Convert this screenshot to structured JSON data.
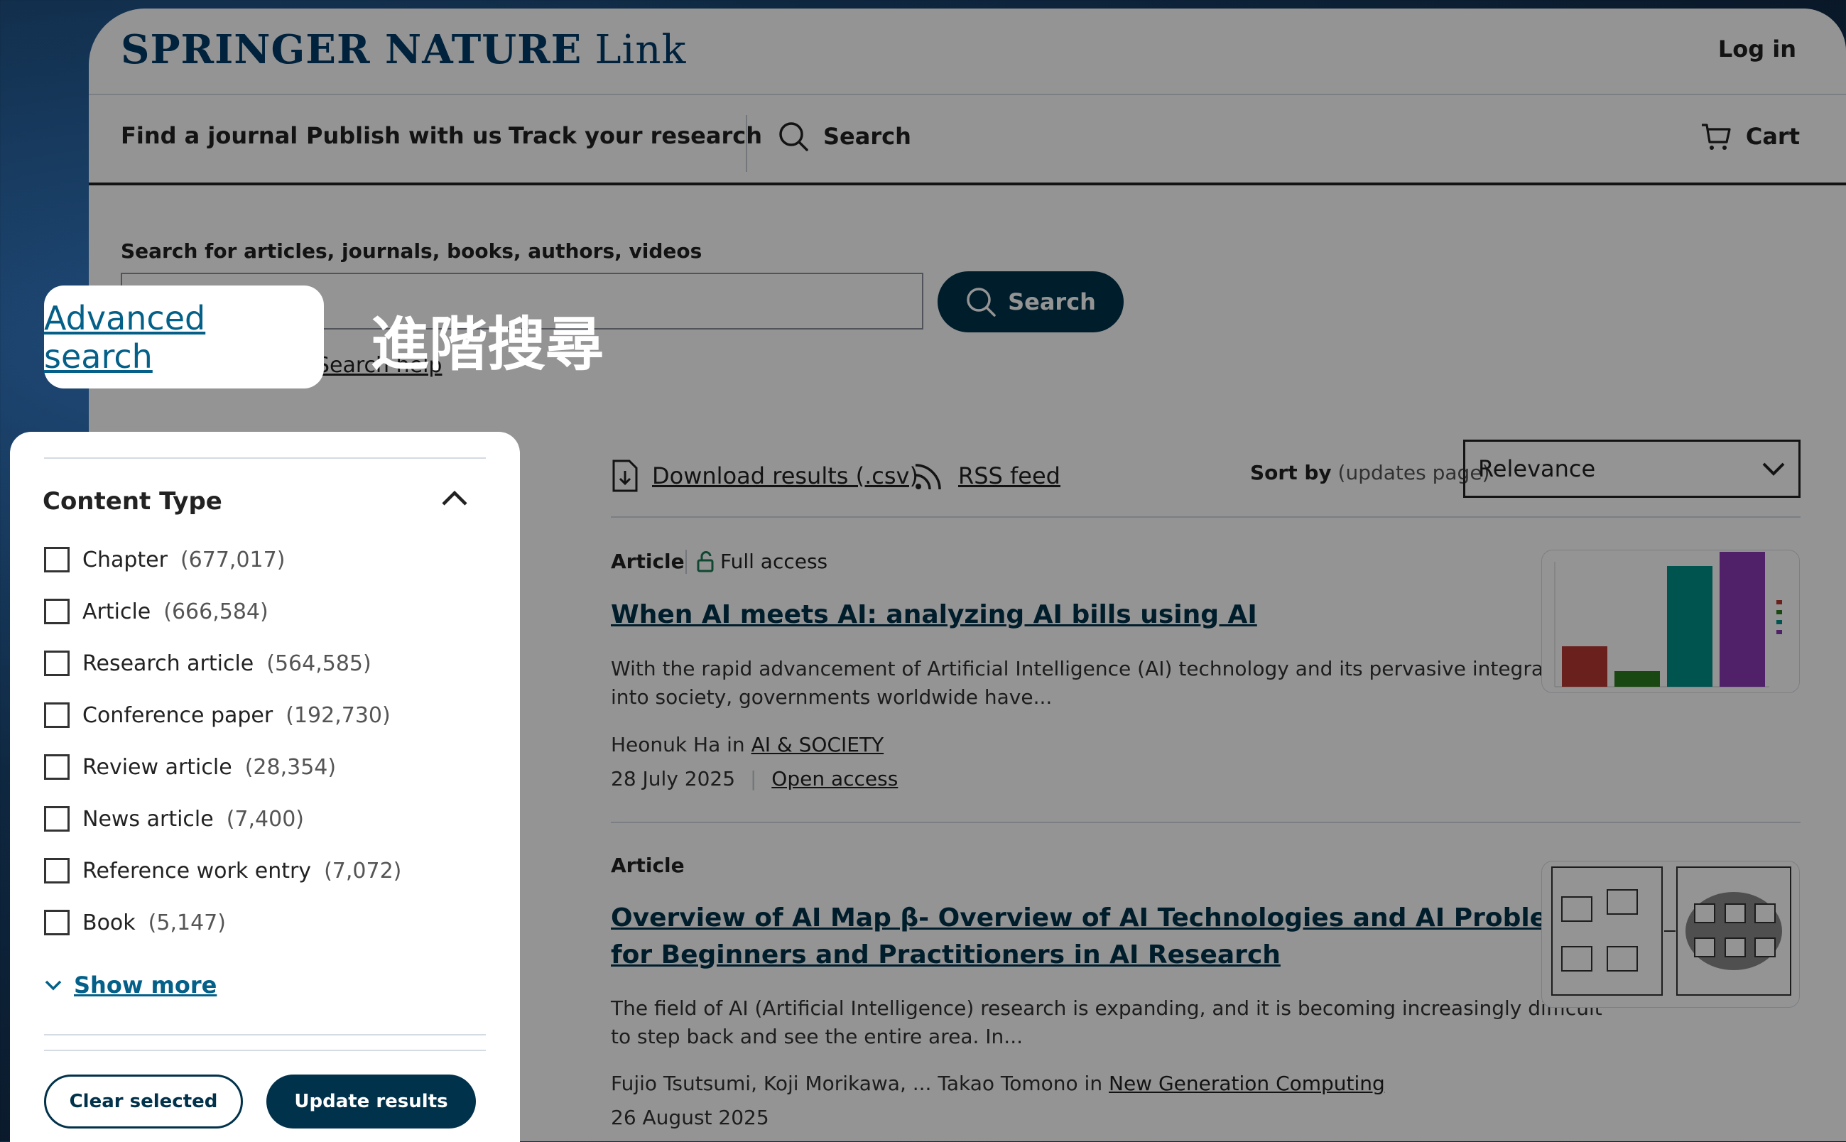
{
  "header": {
    "logo_brand": "SPRINGER NATURE",
    "logo_sub": "Link",
    "login": "Log in"
  },
  "nav": {
    "items": [
      "Find a journal",
      "Publish with us",
      "Track your research"
    ],
    "search": "Search",
    "cart": "Cart"
  },
  "search": {
    "label": "Search for articles, journals, books, authors, videos",
    "button": "Search",
    "help": "Search help"
  },
  "highlight": {
    "advanced_search": "Advanced search",
    "caption": "進階搜尋"
  },
  "filters": {
    "title": "Content Type",
    "items": [
      {
        "label": "Chapter",
        "count": "(677,017)"
      },
      {
        "label": "Article",
        "count": "(666,584)"
      },
      {
        "label": "Research article",
        "count": "(564,585)"
      },
      {
        "label": "Conference paper",
        "count": "(192,730)"
      },
      {
        "label": "Review article",
        "count": "(28,354)"
      },
      {
        "label": "News article",
        "count": "(7,400)"
      },
      {
        "label": "Reference work entry",
        "count": "(7,072)"
      },
      {
        "label": "Book",
        "count": "(5,147)"
      }
    ],
    "show_more": "Show more",
    "clear": "Clear selected",
    "update": "Update results"
  },
  "toolbar": {
    "download": "Download results (.csv)",
    "rss": "RSS feed",
    "sort_label": "Sort by",
    "sort_note": "(updates page)",
    "sort_value": "Relevance"
  },
  "results": [
    {
      "type": "Article",
      "access": "Full access",
      "title": "When AI meets AI: analyzing AI bills using AI",
      "snippet": "With the rapid advancement of Artificial Intelligence (AI) technology and its pervasive integration into society, governments worldwide have...",
      "authors": "Heonuk Ha in",
      "journal": "AI & SOCIETY",
      "date": "28 July 2025",
      "oa": "Open access"
    },
    {
      "type": "Article",
      "title": "Overview of AI Map β- Overview of AI Technologies and AI Problems: for Beginners and Practitioners in AI Research",
      "snippet": "The field of AI (Artificial Intelligence) research is expanding, and it is becoming increasingly difficult to step back and see the entire area. In...",
      "authors": "Fujio Tsutsumi, Koji Morikawa, ... Takao Tomono in",
      "journal": "New Generation Computing",
      "date": "26 August 2025"
    }
  ],
  "colors": {
    "brand": "#013c68",
    "button": "#01324b",
    "link": "#046088"
  }
}
